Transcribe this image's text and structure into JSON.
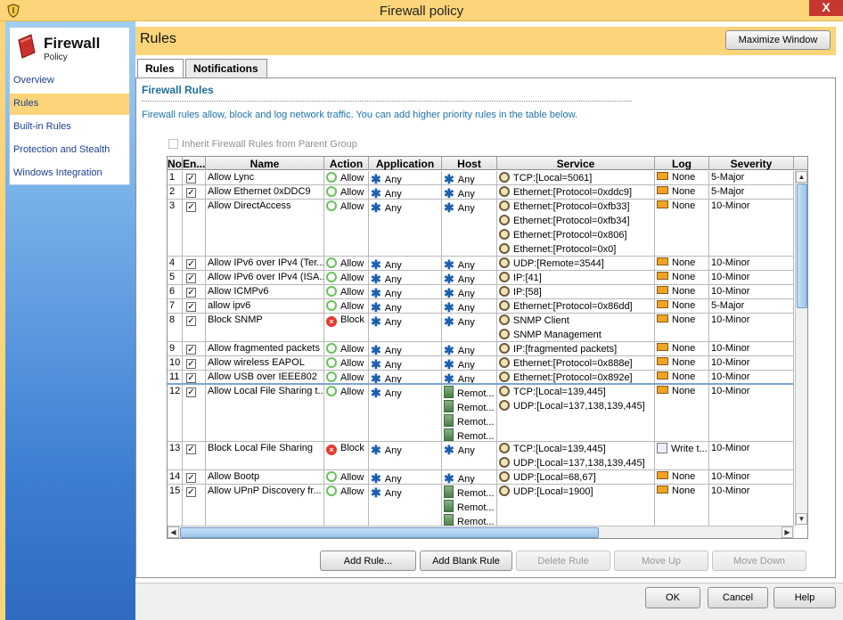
{
  "window": {
    "title": "Firewall policy",
    "close_label": "X",
    "title_icon": "shield-icon"
  },
  "nav": {
    "title": "Firewall",
    "subtitle": "Policy",
    "items": [
      {
        "label": "Overview",
        "active": false
      },
      {
        "label": "Rules",
        "active": true
      },
      {
        "label": "Built-in Rules",
        "active": false
      },
      {
        "label": "Protection and Stealth",
        "active": false
      },
      {
        "label": "Windows Integration",
        "active": false
      }
    ]
  },
  "header": {
    "title": "Rules",
    "maximize_label": "Maximize Window"
  },
  "tabs": [
    {
      "label": "Rules",
      "active": true
    },
    {
      "label": "Notifications",
      "active": false
    }
  ],
  "section": {
    "title": "Firewall Rules",
    "description": "Firewall rules allow, block and log network traffic. You can add higher priority rules in the table below.",
    "inherit_label": "Inherit Firewall Rules from Parent Group",
    "inherit_checked": false
  },
  "table": {
    "columns": [
      "No",
      "En...",
      "Name",
      "Action",
      "Application",
      "Host",
      "Service",
      "Log",
      "Severity"
    ],
    "rows": [
      {
        "no": "1",
        "enabled": true,
        "name": "Allow Lync",
        "action": "Allow",
        "application": "Any",
        "host": [
          "Any"
        ],
        "services": [
          "TCP:[Local=5061]"
        ],
        "log": "None",
        "severity": "5-Major"
      },
      {
        "no": "2",
        "enabled": true,
        "name": "Allow Ethernet 0xDDC9",
        "action": "Allow",
        "application": "Any",
        "host": [
          "Any"
        ],
        "services": [
          "Ethernet:[Protocol=0xddc9]"
        ],
        "log": "None",
        "severity": "5-Major"
      },
      {
        "no": "3",
        "enabled": true,
        "name": "Allow DirectAccess",
        "action": "Allow",
        "application": "Any",
        "host": [
          "Any"
        ],
        "services": [
          "Ethernet:[Protocol=0xfb33]",
          "Ethernet:[Protocol=0xfb34]",
          "Ethernet:[Protocol=0x806]",
          "Ethernet:[Protocol=0x0]"
        ],
        "log": "None",
        "severity": "10-Minor"
      },
      {
        "no": "4",
        "enabled": true,
        "name": "Allow IPv6 over IPv4 (Ter...",
        "action": "Allow",
        "application": "Any",
        "host": [
          "Any"
        ],
        "services": [
          "UDP:[Remote=3544]"
        ],
        "log": "None",
        "severity": "10-Minor"
      },
      {
        "no": "5",
        "enabled": true,
        "name": "Allow IPv6 over IPv4 (ISA...",
        "action": "Allow",
        "application": "Any",
        "host": [
          "Any"
        ],
        "services": [
          "IP:[41]"
        ],
        "log": "None",
        "severity": "10-Minor"
      },
      {
        "no": "6",
        "enabled": true,
        "name": "Allow  ICMPv6",
        "action": "Allow",
        "application": "Any",
        "host": [
          "Any"
        ],
        "services": [
          "IP:[58]"
        ],
        "log": "None",
        "severity": "10-Minor"
      },
      {
        "no": "7",
        "enabled": true,
        "name": "allow ipv6",
        "action": "Allow",
        "application": "Any",
        "host": [
          "Any"
        ],
        "services": [
          "Ethernet:[Protocol=0x86dd]"
        ],
        "log": "None",
        "severity": "5-Major"
      },
      {
        "no": "8",
        "enabled": true,
        "name": "Block SNMP",
        "action": "Block",
        "application": "Any",
        "host": [
          "Any"
        ],
        "services": [
          "SNMP Client",
          "SNMP Management"
        ],
        "log": "None",
        "severity": "10-Minor"
      },
      {
        "no": "9",
        "enabled": true,
        "name": "Allow fragmented packets",
        "action": "Allow",
        "application": "Any",
        "host": [
          "Any"
        ],
        "services": [
          "IP:[fragmented packets]"
        ],
        "log": "None",
        "severity": "10-Minor"
      },
      {
        "no": "10",
        "enabled": true,
        "name": "Allow wireless EAPOL",
        "action": "Allow",
        "application": "Any",
        "host": [
          "Any"
        ],
        "services": [
          "Ethernet:[Protocol=0x888e]"
        ],
        "log": "None",
        "severity": "10-Minor"
      },
      {
        "no": "11",
        "enabled": true,
        "name": "Allow USB over IEEE802",
        "action": "Allow",
        "application": "Any",
        "host": [
          "Any"
        ],
        "services": [
          "Ethernet:[Protocol=0x892e]"
        ],
        "log": "None",
        "severity": "10-Minor"
      },
      {
        "no": "12",
        "enabled": true,
        "name": "Allow Local File Sharing t...",
        "action": "Allow",
        "application": "Any",
        "host": [
          "Remot...",
          "Remot...",
          "Remot...",
          "Remot..."
        ],
        "services": [
          "TCP:[Local=139,445]",
          "UDP:[Local=137,138,139,445]"
        ],
        "log": "None",
        "severity": "10-Minor"
      },
      {
        "no": "13",
        "enabled": true,
        "name": "Block Local File Sharing",
        "action": "Block",
        "application": "Any",
        "host": [
          "Any"
        ],
        "services": [
          "TCP:[Local=139,445]",
          "UDP:[Local=137,138,139,445]"
        ],
        "log": "Write t...",
        "severity": "10-Minor"
      },
      {
        "no": "14",
        "enabled": true,
        "name": "Allow Bootp",
        "action": "Allow",
        "application": "Any",
        "host": [
          "Any"
        ],
        "services": [
          "UDP:[Local=68,67]"
        ],
        "log": "None",
        "severity": "10-Minor"
      },
      {
        "no": "15",
        "enabled": true,
        "name": "Allow UPnP Discovery fr...",
        "action": "Allow",
        "application": "Any",
        "host": [
          "Remot...",
          "Remot...",
          "Remot..."
        ],
        "services": [
          "UDP:[Local=1900]"
        ],
        "log": "None",
        "severity": "10-Minor"
      }
    ]
  },
  "table_buttons": [
    {
      "label": "Add Rule...",
      "enabled": true
    },
    {
      "label": "Add Blank Rule",
      "enabled": true
    },
    {
      "label": "Delete Rule",
      "enabled": false
    },
    {
      "label": "Move Up",
      "enabled": false
    },
    {
      "label": "Move Down",
      "enabled": false
    }
  ],
  "dialog_buttons": {
    "ok": "OK",
    "cancel": "Cancel",
    "help": "Help"
  }
}
